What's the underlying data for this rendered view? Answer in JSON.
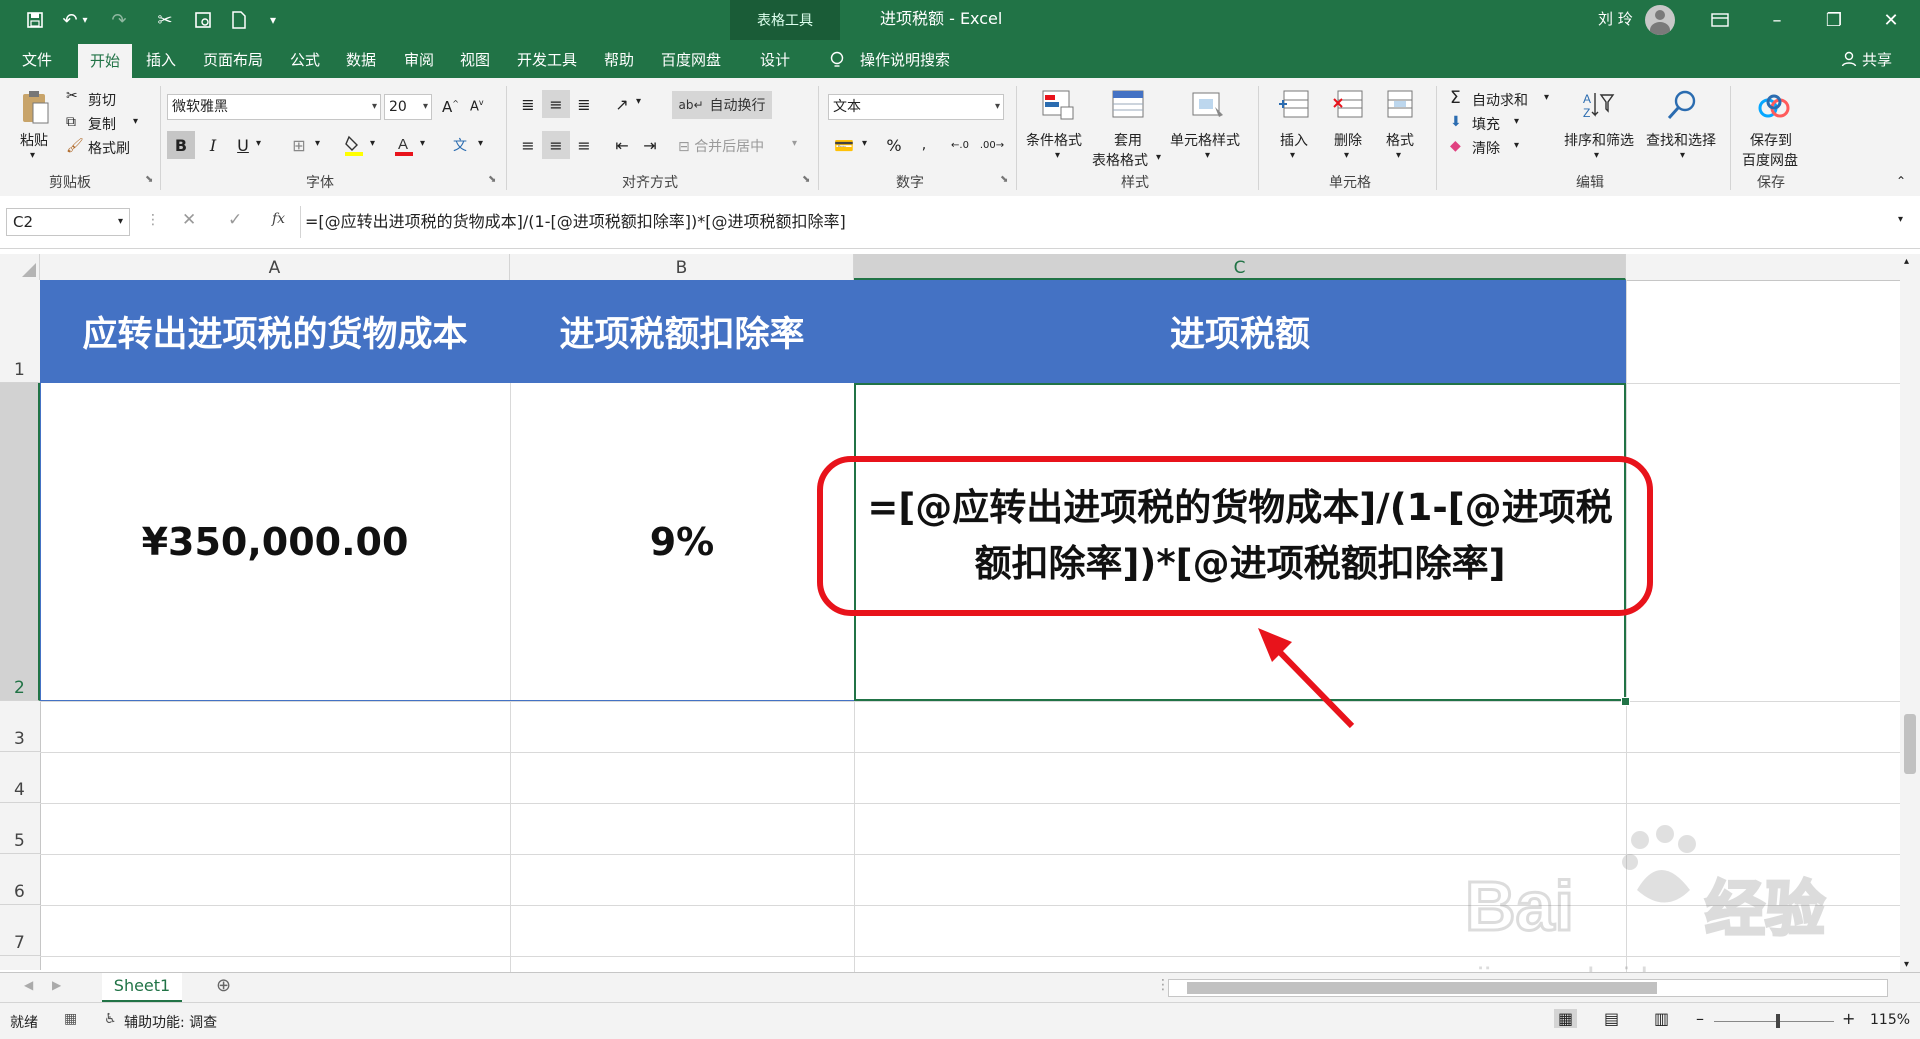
{
  "titlebar": {
    "context_group": "表格工具",
    "doc_title": "进项税额 - Excel",
    "user": "刘 玲"
  },
  "tabs": {
    "items": [
      "文件",
      "开始",
      "插入",
      "页面布局",
      "公式",
      "数据",
      "审阅",
      "视图",
      "开发工具",
      "帮助",
      "百度网盘",
      "设计"
    ],
    "search": "操作说明搜索",
    "share": "共享"
  },
  "ribbon": {
    "clipboard": {
      "paste": "粘贴",
      "cut": "剪切",
      "copy": "复制",
      "format_painter": "格式刷",
      "label": "剪贴板"
    },
    "font": {
      "name": "微软雅黑",
      "size": "20",
      "label": "字体"
    },
    "alignment": {
      "wrap_text": "自动换行",
      "merge_center": "合并后居中",
      "label": "对齐方式"
    },
    "number": {
      "format": "文本",
      "label": "数字"
    },
    "styles": {
      "conditional": "条件格式",
      "table_format_1": "套用",
      "table_format_2": "表格格式",
      "cell_styles": "单元格样式",
      "label": "样式"
    },
    "cells": {
      "insert": "插入",
      "delete": "删除",
      "format": "格式",
      "label": "单元格"
    },
    "editing": {
      "autosum": "自动求和",
      "fill": "填充",
      "clear": "清除",
      "sort_filter": "排序和筛选",
      "find_select": "查找和选择",
      "label": "编辑"
    },
    "save": {
      "save_to_1": "保存到",
      "save_to_2": "百度网盘",
      "label": "保存"
    }
  },
  "formula_bar": {
    "name_box": "C2",
    "fx": "fx",
    "formula": "=[@应转出进项税的货物成本]/(1-[@进项税额扣除率])*[@进项税额扣除率]"
  },
  "grid": {
    "columns": [
      "A",
      "B",
      "C"
    ],
    "rows": [
      "1",
      "2",
      "3",
      "4",
      "5",
      "6",
      "7"
    ],
    "headers": [
      "应转出进项税的货物成本",
      "进项税额扣除率",
      "进项税额"
    ],
    "cost_value": "¥350,000.00",
    "rate_value": "9%",
    "c2_line1": "=[@应转出进项税的货物成本]/(1-[@进项税",
    "c2_line2": "额扣除率])*[@进项税额扣除率]"
  },
  "sheets": {
    "active": "Sheet1"
  },
  "status": {
    "ready": "就绪",
    "accessibility": "辅助功能: 调查",
    "zoom": "115%"
  },
  "watermark": {
    "brand": "Bai du 经验",
    "url": "jingyan.baidu.com"
  },
  "colors": {
    "excel_green": "#217346",
    "header_fill": "#4472c4",
    "highlight_red": "#e8131b"
  }
}
